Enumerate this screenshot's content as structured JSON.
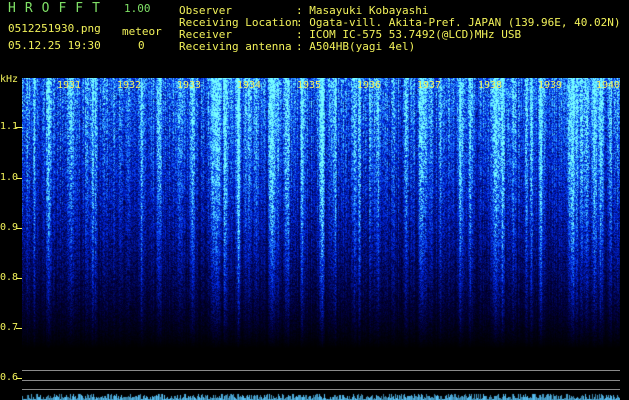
{
  "header": {
    "app_title": "HROFFT",
    "app_version": "1.00",
    "file_name": "0512251930.png",
    "timestamp": "05.12.25 19:30",
    "meteor_label": "meteor",
    "meteor_count": "0"
  },
  "info": {
    "observer_label": "Observer",
    "observer_value": ": Masayuki Kobayashi",
    "location_label": "Receiving Location",
    "location_value": ": Ogata-vill. Akita-Pref. JAPAN (139.96E, 40.02N)",
    "receiver_label": "Receiver",
    "receiver_value": ": ICOM IC-575 53.7492(@LCD)MHz USB",
    "antenna_label": "Receiving antenna",
    "antenna_value": ": A504HB(yagi 4el)"
  },
  "spectrogram": {
    "y_unit": "kHz",
    "y_ticks": [
      "1.1",
      "1.0",
      "0.9",
      "0.8",
      "0.7",
      "0.6"
    ],
    "x_ticks": [
      "1931",
      "1932",
      "1933",
      "1934",
      "1935",
      "1936",
      "1937",
      "1938",
      "1939",
      "1940"
    ],
    "colors": {
      "background": "#000000",
      "signal_low": "#0a1a6a",
      "signal_mid": "#2a4aff",
      "signal_high": "#5fd0ff",
      "label": "#f2f25a",
      "title": "#7fe066",
      "baseline": "#7fe0ff"
    }
  }
}
